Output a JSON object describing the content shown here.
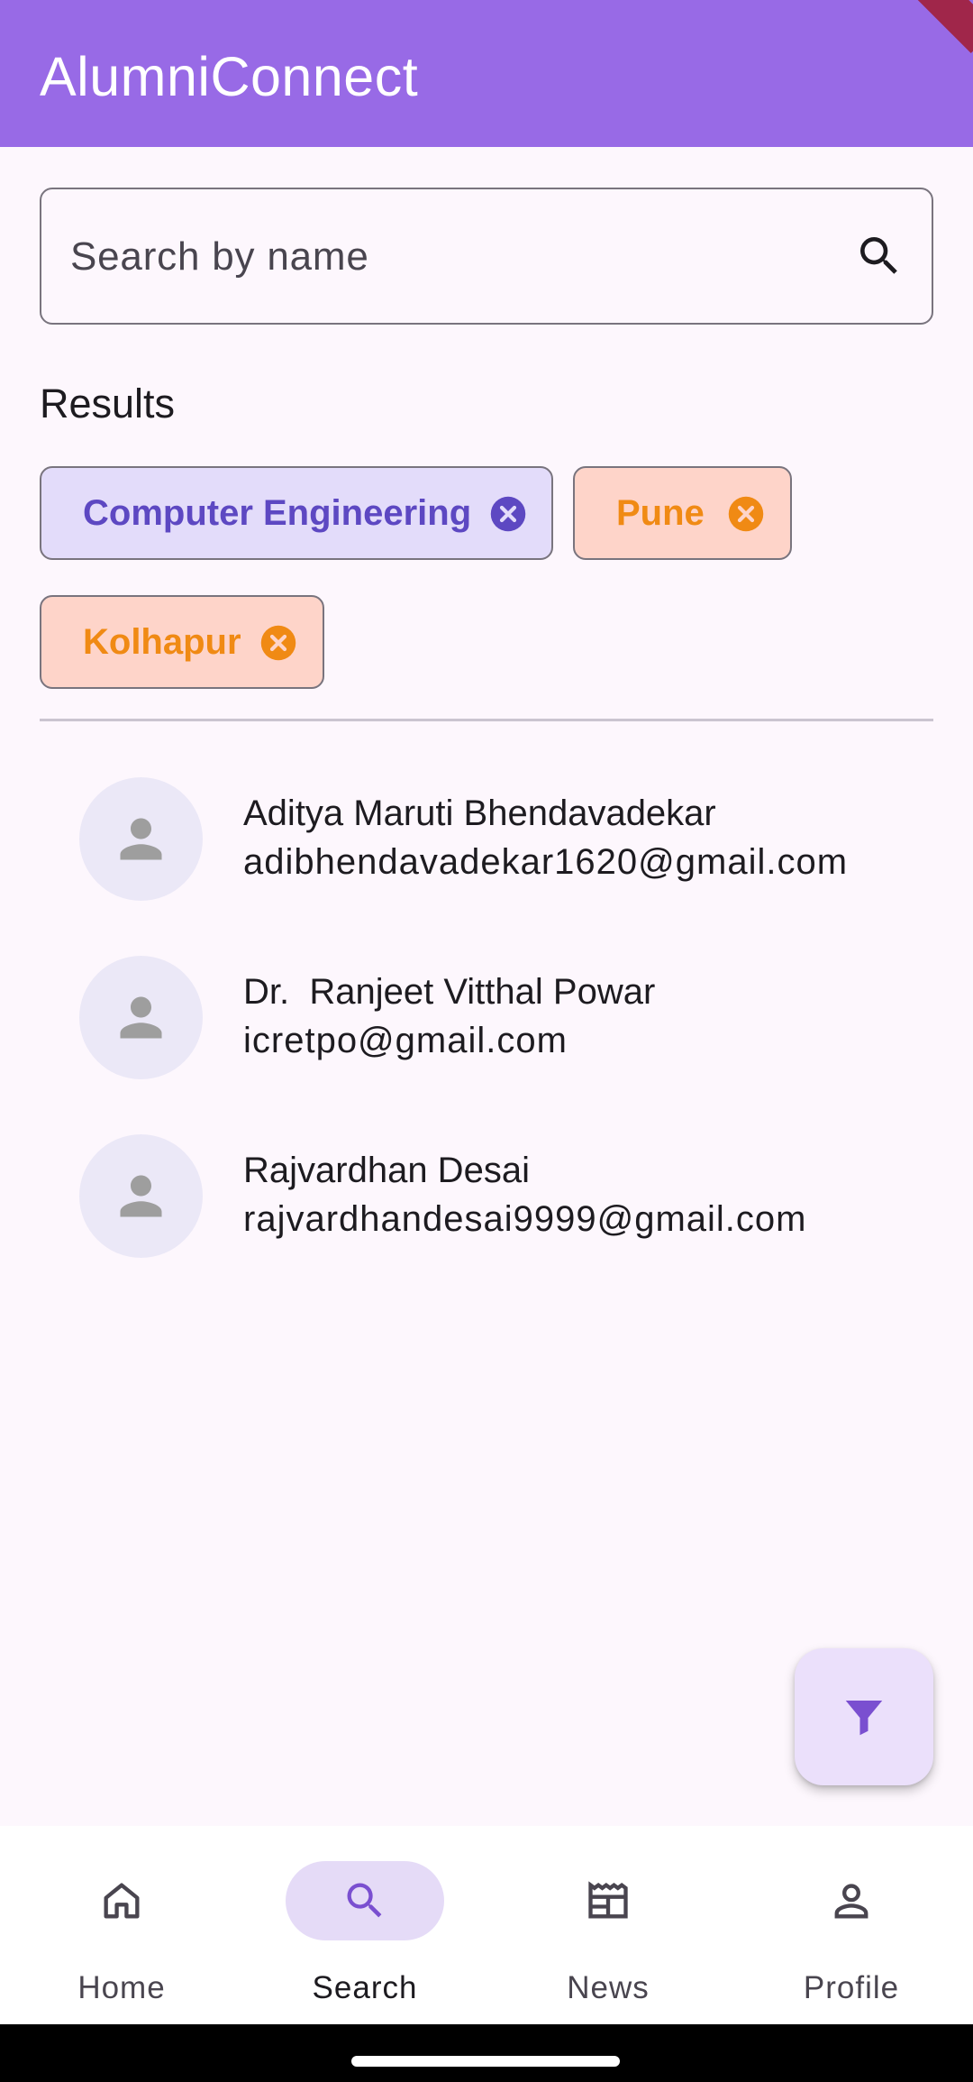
{
  "app": {
    "title": "AlumniConnect"
  },
  "search": {
    "placeholder": "Search by name",
    "value": ""
  },
  "results": {
    "heading": "Results"
  },
  "filters": [
    {
      "label": "Computer Engineering",
      "color": "#5d48c2"
    },
    {
      "label": "Pune",
      "color": "#f08a14"
    },
    {
      "label": "Kolhapur",
      "color": "#f08a14"
    }
  ],
  "alumni": [
    {
      "name": "Aditya Maruti Bhendavadekar",
      "email": "adibhendavadekar1620@gmail.com"
    },
    {
      "name": "Dr.  Ranjeet Vitthal Powar",
      "email": "icretpo@gmail.com"
    },
    {
      "name": "Rajvardhan Desai",
      "email": "rajvardhandesai9999@gmail.com"
    }
  ],
  "fab": {
    "icon": "filter-icon"
  },
  "nav": {
    "items": [
      {
        "label": "Home",
        "icon": "home-icon"
      },
      {
        "label": "Search",
        "icon": "search-icon"
      },
      {
        "label": "News",
        "icon": "news-icon"
      },
      {
        "label": "Profile",
        "icon": "profile-icon"
      }
    ],
    "active": "Search"
  },
  "colors": {
    "appbar": "#986ae6",
    "background": "#fdf7fd",
    "accent": "#986ae6",
    "chip_purple_bg": "#e3dcfa",
    "chip_orange_bg": "#fed4c9",
    "chip_orange_text": "#f08a14",
    "chip_purple_text": "#5d48c2"
  }
}
